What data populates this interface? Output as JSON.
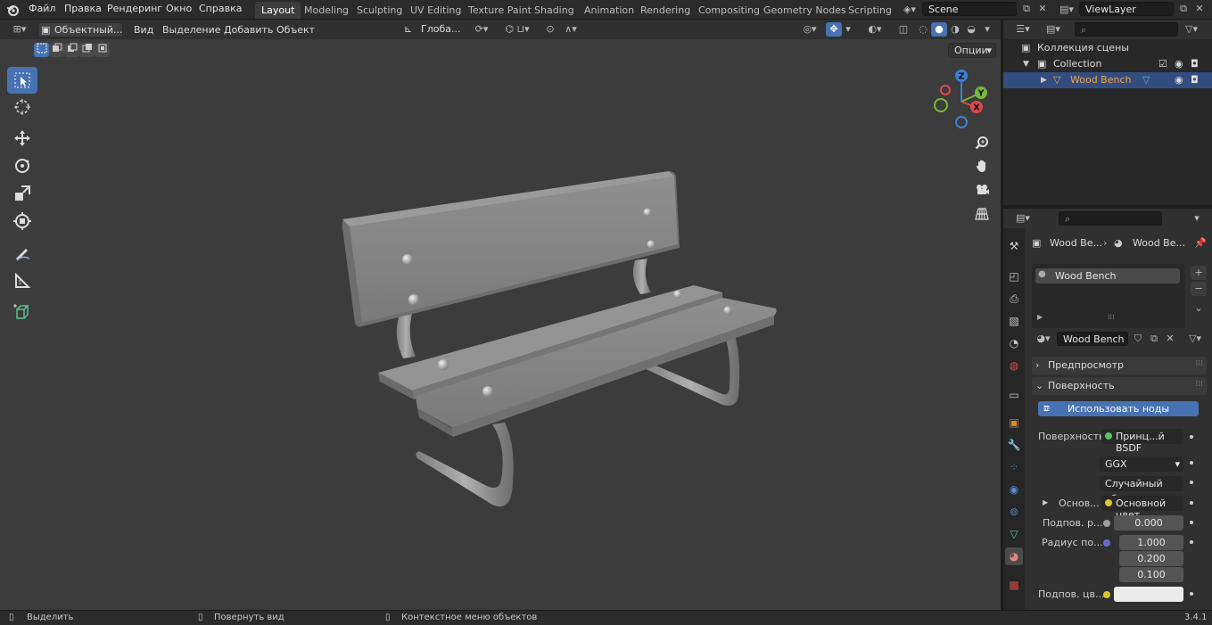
{
  "topbar": {
    "menus": [
      "Файл",
      "Правка",
      "Рендеринг",
      "Окно",
      "Справка"
    ],
    "workspaces": [
      "Layout",
      "Modeling",
      "Sculpting",
      "UV Editing",
      "Texture Paint",
      "Shading",
      "Animation",
      "Rendering",
      "Compositing",
      "Geometry Nodes",
      "Scripting"
    ],
    "active_workspace": "Layout",
    "scene": "Scene",
    "view_layer": "ViewLayer"
  },
  "viewport": {
    "mode": "Объектный...",
    "menus": [
      "Вид",
      "Выделение",
      "Добавить",
      "Объект"
    ],
    "transform_orientation": "Глоба...",
    "options_label": "Опции",
    "gizmo": {
      "z": "Z",
      "y": "Y",
      "x": "X"
    }
  },
  "outliner": {
    "root": "Коллекция сцены",
    "collection": "Collection",
    "object": "Wood Bench"
  },
  "properties": {
    "breadcrumb": [
      "Wood Be...",
      "Wood Be..."
    ],
    "material_slot": "Wood Bench",
    "material_name": "Wood Bench",
    "sections": {
      "preview": "Предпросмотр",
      "surface": "Поверхность"
    },
    "use_nodes_label": "Использовать ноды",
    "surface_label": "Поверхность",
    "surface_shader": "Принц...й BSDF",
    "distribution": "GGX",
    "subsurface_method": "Случайный об...",
    "base_label": "Основ...",
    "base_value": "Основной цвет",
    "subsurface_label": "Подпов. р...",
    "subsurface_value": "0.000",
    "radius_label": "Радиус по...",
    "radius_values": [
      "1.000",
      "0.200",
      "0.100"
    ],
    "subsurface_color_label": "Подпов. цв..."
  },
  "statusbar": {
    "select": "Выделить",
    "rotate": "Повернуть вид",
    "context": "Контекстное меню объектов",
    "version": "3.4.1"
  },
  "colors": {
    "accent": "#4772b3",
    "selected_object": "#f1a448",
    "viewport_bg": "#3c3c3c"
  }
}
